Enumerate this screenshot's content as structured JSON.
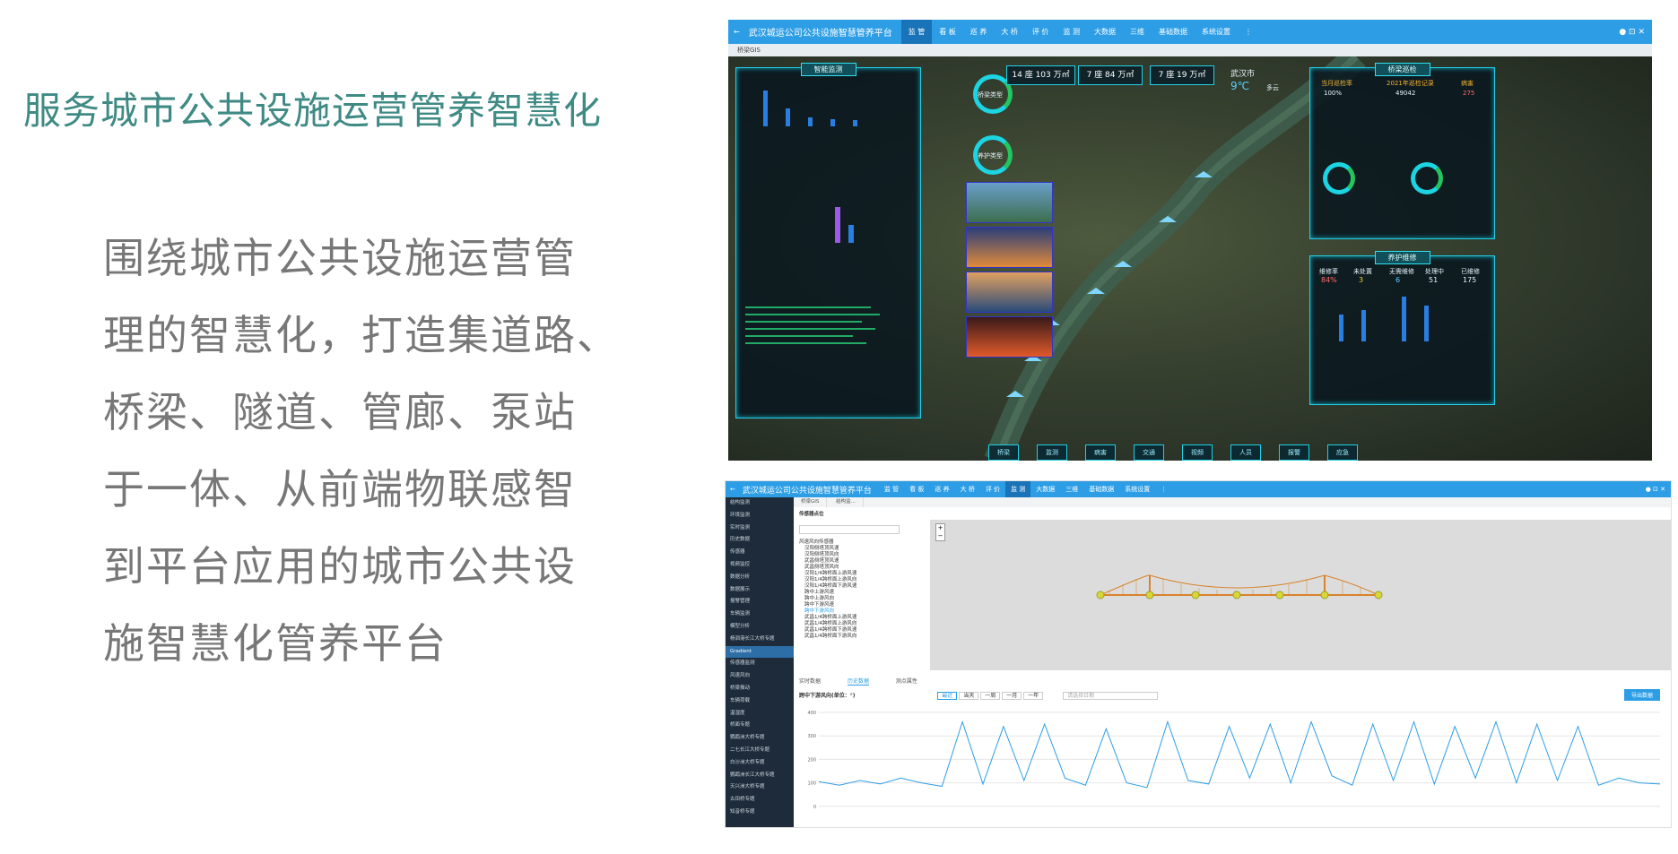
{
  "slide": {
    "title": "服务城市公共设施运营管养智慧化",
    "body_lines": [
      "围绕城市公共设施运营管",
      "理的智慧化，打造集道路、",
      "桥梁、隧道、管廊、泵站",
      "于一体、从前端物联感智",
      "到平台应用的城市公共设",
      "施智慧化管养平台"
    ]
  },
  "screen1": {
    "app_title": "武汉城运公司公共设施智慧管养平台",
    "menu": [
      "监 管",
      "看 板",
      "巡 养",
      "大 桥",
      "评 价",
      "监 测",
      "大数据",
      "三维",
      "基础数据",
      "系统设置"
    ],
    "active_menu_index": 0,
    "subbar": "桥梁GIS",
    "left_panel_title": "智能监测",
    "right_panel_title": "桥梁巡检",
    "right_panel2_title": "养护维修",
    "stats": [
      "14 座 103 万㎡",
      "7 座 84 万㎡",
      "7 座 19 万㎡"
    ],
    "city": {
      "name": "武汉市",
      "temp": "9℃",
      "weather": "多云"
    },
    "inspection": {
      "labels": [
        "当月巡检率",
        "2021年巡检记录",
        "病害"
      ],
      "values": [
        "100%",
        "49042",
        "275"
      ]
    },
    "maintenance": {
      "labels": [
        "维修率",
        "未处置",
        "无需维修",
        "处理中",
        "已维修"
      ],
      "values": [
        "84%",
        "3",
        "6",
        "51",
        "175"
      ]
    },
    "rings": [
      "桥梁类型",
      "养护类型"
    ],
    "bottom_nav": [
      "桥梁",
      "监测",
      "病害",
      "交通",
      "视频",
      "人员",
      "报警",
      "应急"
    ],
    "colors": {
      "accent": "#1fd0e6",
      "brand": "#2d9ee6"
    }
  },
  "screen2": {
    "app_title": "武汉城运公司公共设施智慧管养平台",
    "menu": [
      "监 管",
      "看 板",
      "巡 养",
      "大 桥",
      "评 价",
      "监 测",
      "大数据",
      "三维",
      "基础数据",
      "系统设置"
    ],
    "active_menu_index": 5,
    "tabs": [
      "桥梁GIS",
      "结构监..."
    ],
    "sidebar": [
      "结构监测",
      "环境监测",
      "实时监测",
      "历史数据",
      "传感器",
      "视频监控",
      "数据分析",
      "数据展示",
      "报警管理",
      "车辆监测",
      "模型分析",
      "杨泗港长江大桥专题",
      "Gradient",
      "传感器监测",
      "风速风向",
      "桥梁振动",
      "车辆荷载",
      "温湿度",
      "桥面专题",
      "鹦鹉洲大桥专题",
      "二七长江大桥专题",
      "白沙洲大桥专题",
      "鹦鹉洲长江大桥专题",
      "天兴洲大桥专题",
      "古田桥专题",
      "知音桥专题"
    ],
    "tree_title": "传感器点位",
    "tree_items": [
      "风速风向传感器",
      "汉阳侧塔顶风速",
      "汉阳侧塔顶风向",
      "武昌侧塔顶风速",
      "武昌侧塔顶风向",
      "汉阳1/4跨桥面上游风速",
      "汉阳1/4跨桥面上游风向",
      "汉阳1/4跨桥面下游风速",
      "跨中上游风速",
      "跨中上游风向",
      "跨中下游风速",
      "跨中下游风向",
      "武昌1/4跨桥面上游风速",
      "武昌1/4跨桥面上游风向",
      "武昌1/4跨桥面下游风速",
      "武昌1/4跨桥面下游风向"
    ],
    "sub_tabs": [
      "实时数据",
      "历史数据",
      "测点属性"
    ],
    "active_sub_tab": 1,
    "series_label": "跨中下游风向(单位：°)",
    "range_buttons": [
      "最近",
      "当天",
      "一周",
      "一月",
      "一年"
    ],
    "action_button": "导出数据",
    "date_placeholder": "请选择日期",
    "chart_data": {
      "type": "line",
      "ylim": [
        -20,
        400
      ],
      "y_ticks": [
        0,
        100,
        200,
        300,
        400
      ],
      "grid": true,
      "series": [
        {
          "values": [
            105,
            90,
            110,
            95,
            120,
            100,
            85,
            360,
            95,
            340,
            110,
            350,
            120,
            90,
            330,
            100,
            80,
            360,
            110,
            95,
            340,
            120,
            350,
            100,
            360,
            130,
            90,
            350,
            110,
            360,
            95,
            340,
            120,
            360,
            100,
            350,
            110,
            340,
            90,
            120,
            100,
            95
          ]
        }
      ],
      "color": "#2d9ee6"
    }
  }
}
